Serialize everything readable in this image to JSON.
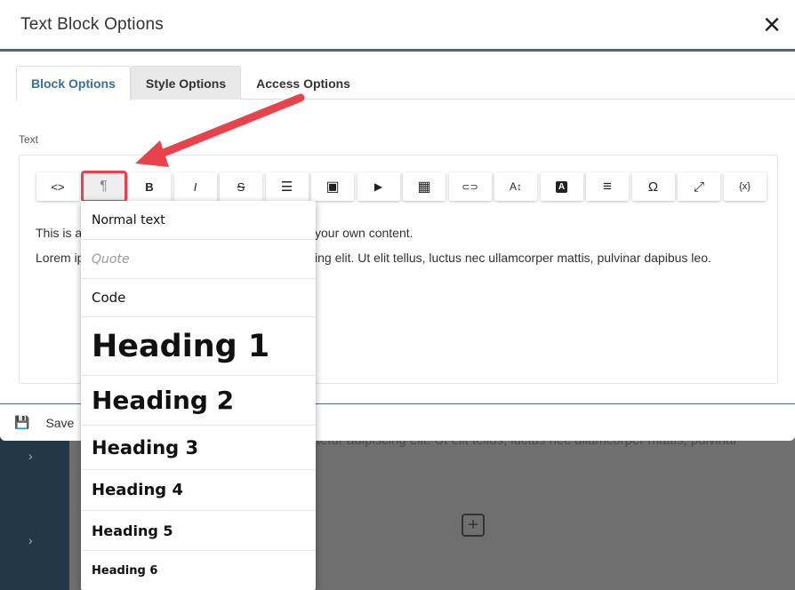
{
  "modal": {
    "title": "Text Block Options",
    "close_icon": "×"
  },
  "tabs": [
    {
      "label": "Block Options"
    },
    {
      "label": "Style Options"
    },
    {
      "label": "Access Options"
    }
  ],
  "editor": {
    "field_label": "Text",
    "toolbar": [
      {
        "icon": "code-icon",
        "glyph": "<>"
      },
      {
        "icon": "paragraph-icon",
        "glyph": "¶"
      },
      {
        "icon": "bold-icon",
        "glyph": "B"
      },
      {
        "icon": "italic-icon",
        "glyph": "I"
      },
      {
        "icon": "strikethrough-icon",
        "glyph": "S"
      },
      {
        "icon": "list-icon",
        "glyph": "☰"
      },
      {
        "icon": "image-icon",
        "glyph": "▣"
      },
      {
        "icon": "video-icon",
        "glyph": "▶"
      },
      {
        "icon": "table-icon",
        "glyph": "▦"
      },
      {
        "icon": "link-icon",
        "glyph": "⊂⊃"
      },
      {
        "icon": "font-size-icon",
        "glyph": "A↕"
      },
      {
        "icon": "text-color-icon",
        "glyph": "A"
      },
      {
        "icon": "align-icon",
        "glyph": "≡"
      },
      {
        "icon": "special-char-icon",
        "glyph": "Ω"
      },
      {
        "icon": "fullscreen-icon",
        "glyph": "⤢"
      },
      {
        "icon": "variables-icon",
        "glyph": "{x}"
      }
    ],
    "line1_left": "This is a",
    "line1_right": "your own content.",
    "line2_left": "Lorem ip",
    "line2_right": "ing elit. Ut elit tellus, luctus nec ullamcorper mattis, pulvinar dapibus leo."
  },
  "dropdown": {
    "items": [
      {
        "label": "Normal text"
      },
      {
        "label": "Quote"
      },
      {
        "label": "Code"
      },
      {
        "label": "Heading 1"
      },
      {
        "label": "Heading 2"
      },
      {
        "label": "Heading 3"
      },
      {
        "label": "Heading 4"
      },
      {
        "label": "Heading 5"
      },
      {
        "label": "Heading 6"
      }
    ]
  },
  "footer": {
    "save_label": "Save",
    "save_icon": "save-icon"
  },
  "background": {
    "text": "ectetur adipiscing elit. Ut elit tellus, luctus nec ullamcorper mattis, pulvinar",
    "add_glyph": "+",
    "chevron": "›"
  },
  "colors": {
    "accent": "#3a6f97",
    "highlight": "#e8434a",
    "sidebar": "#233746"
  }
}
